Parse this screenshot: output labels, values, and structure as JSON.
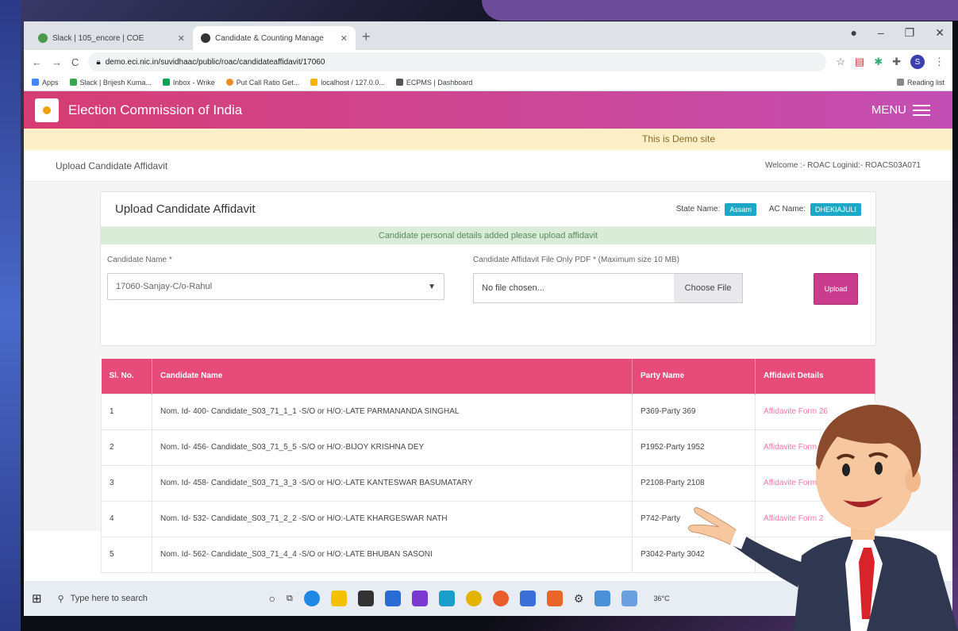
{
  "browser": {
    "tabs": [
      {
        "title": "Slack | 105_encore | COE",
        "active": false
      },
      {
        "title": "Candidate & Counting Manage",
        "active": true
      }
    ],
    "url": "demo.eci.nic.in/suvidhaac/public/roac/candidateaffidavit/17060",
    "bookmarks": [
      "Apps",
      "Slack | Brijesh Kuma...",
      "Inbox - Wrike",
      "Put Call Ratio Get...",
      "localhost / 127.0.0...",
      "ECPMS | Dashboard"
    ],
    "reading_list": "Reading list",
    "profile_initial": "S"
  },
  "header": {
    "title": "Election Commission of India",
    "menu_label": "MENU"
  },
  "demo_banner": "This is Demo site",
  "breadcrumb": {
    "page": "Upload Candidate Affidavit",
    "welcome": "Welcome :- ROAC Loginid:- ROACS03A071"
  },
  "card": {
    "title": "Upload Candidate Affidavit",
    "state_label": "State Name:",
    "state_value": "Assam",
    "ac_label": "AC Name:",
    "ac_value": "DHEKIAJULI",
    "alert": "Candidate personal details added please upload affidavit",
    "candidate_label": "Candidate Name *",
    "candidate_value": "17060-Sanjay-C/o-Rahul",
    "file_label": "Candidate Affidavit File Only PDF * (Maximum size 10 MB)",
    "file_value": "No file chosen...",
    "choose_label": "Choose File",
    "upload_label": "Upload"
  },
  "table": {
    "headers": [
      "Sl. No.",
      "Candidate Name",
      "Party Name",
      "Affidavit Details"
    ],
    "rows": [
      [
        "1",
        "Nom. Id- 400- Candidate_S03_71_1_1 -S/O or H/O:-LATE PARMANANDA SINGHAL",
        "P369-Party 369",
        "Affidavite Form 26"
      ],
      [
        "2",
        "Nom. Id- 456- Candidate_S03_71_5_5 -S/O or H/O:-BIJOY KRISHNA DEY",
        "P1952-Party 1952",
        "Affidavite Form"
      ],
      [
        "3",
        "Nom. Id- 458- Candidate_S03_71_3_3 -S/O or H/O:-LATE KANTESWAR BASUMATARY",
        "P2108-Party 2108",
        "Affidavite Form"
      ],
      [
        "4",
        "Nom. Id- 532- Candidate_S03_71_2_2 -S/O or H/O:-LATE KHARGESWAR NATH",
        "P742-Party",
        "Affidavite Form 2"
      ],
      [
        "5",
        "Nom. Id- 562- Candidate_S03_71_4_4 -S/O or H/O:-LATE BHUBAN SASONI",
        "P3042-Party 3042",
        ""
      ]
    ]
  },
  "taskbar": {
    "search_placeholder": "Type here to search",
    "temperature": "36°C"
  }
}
